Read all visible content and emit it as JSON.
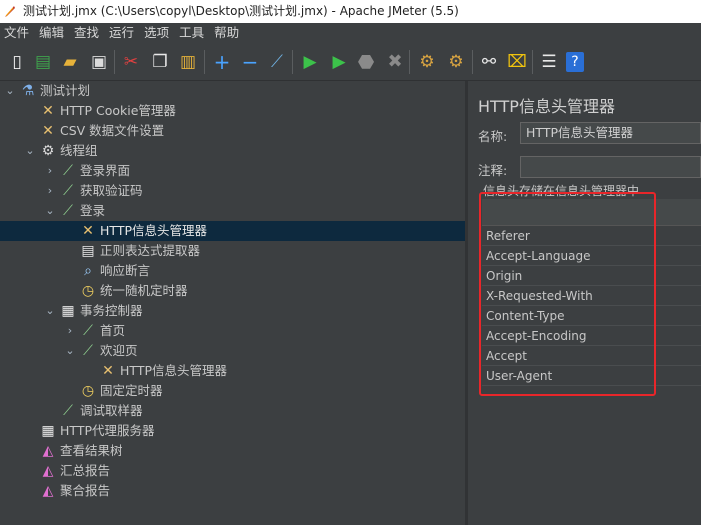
{
  "window": {
    "title": "测试计划.jmx (C:\\Users\\copyl\\Desktop\\测试计划.jmx) - Apache JMeter (5.5)"
  },
  "menu": [
    "文件",
    "编辑",
    "查找",
    "运行",
    "选项",
    "工具",
    "帮助"
  ],
  "toolbar": [
    "new-icon",
    "templates-icon",
    "open-icon",
    "save-icon",
    "cut-icon",
    "copy-icon",
    "paste-icon",
    "expand-icon",
    "collapse-icon",
    "toggle-icon",
    "start-icon",
    "start-no-pause-icon",
    "stop-icon",
    "shutdown-icon",
    "clear-icon",
    "clear-all-icon",
    "search-icon",
    "reset-search-icon",
    "function-helper-icon",
    "help-icon"
  ],
  "tree": [
    {
      "label": "测试计划",
      "level": 0,
      "expand": "open",
      "icon": "flask-icon"
    },
    {
      "label": "HTTP Cookie管理器",
      "level": 1,
      "expand": "none",
      "icon": "wrench-icon"
    },
    {
      "label": "CSV 数据文件设置",
      "level": 1,
      "expand": "none",
      "icon": "wrench-icon"
    },
    {
      "label": "线程组",
      "level": 1,
      "expand": "open",
      "icon": "gear-icon"
    },
    {
      "label": "登录界面",
      "level": 2,
      "expand": "closed",
      "icon": "pipette-icon"
    },
    {
      "label": "获取验证码",
      "level": 2,
      "expand": "closed",
      "icon": "pipette-icon"
    },
    {
      "label": "登录",
      "level": 2,
      "expand": "open",
      "icon": "pipette-icon"
    },
    {
      "label": "HTTP信息头管理器",
      "level": 3,
      "expand": "none",
      "icon": "wrench-icon",
      "selected": true
    },
    {
      "label": "正则表达式提取器",
      "level": 3,
      "expand": "none",
      "icon": "document-icon"
    },
    {
      "label": "响应断言",
      "level": 3,
      "expand": "none",
      "icon": "magnifier-icon"
    },
    {
      "label": "统一随机定时器",
      "level": 3,
      "expand": "none",
      "icon": "clock-icon"
    },
    {
      "label": "事务控制器",
      "level": 2,
      "expand": "open",
      "icon": "controller-icon"
    },
    {
      "label": "首页",
      "level": 3,
      "expand": "closed",
      "icon": "pipette-icon"
    },
    {
      "label": "欢迎页",
      "level": 3,
      "expand": "open",
      "icon": "pipette-icon"
    },
    {
      "label": "HTTP信息头管理器",
      "level": 4,
      "expand": "none",
      "icon": "wrench-icon"
    },
    {
      "label": "固定定时器",
      "level": 3,
      "expand": "none",
      "icon": "clock-icon"
    },
    {
      "label": "调试取样器",
      "level": 2,
      "expand": "none",
      "icon": "pipette-icon"
    },
    {
      "label": "HTTP代理服务器",
      "level": 1,
      "expand": "none",
      "icon": "controller-icon"
    },
    {
      "label": "查看结果树",
      "level": 1,
      "expand": "none",
      "icon": "graph-icon"
    },
    {
      "label": "汇总报告",
      "level": 1,
      "expand": "none",
      "icon": "graph-icon"
    },
    {
      "label": "聚合报告",
      "level": 1,
      "expand": "none",
      "icon": "graph-icon"
    }
  ],
  "panel": {
    "title": "HTTP信息头管理器",
    "name_label": "名称:",
    "name_value": "HTTP信息头管理器",
    "comment_label": "注释:",
    "comment_value": "",
    "group_title": "信息头存储在信息头管理器中",
    "headers": [
      "Referer",
      "Accept-Language",
      "Origin",
      "X-Requested-With",
      "Content-Type",
      "Accept-Encoding",
      "Accept",
      "User-Agent"
    ]
  },
  "colors": {
    "background": "#3c3f41",
    "selection": "#0d293e",
    "highlight_box": "#e8262a"
  }
}
